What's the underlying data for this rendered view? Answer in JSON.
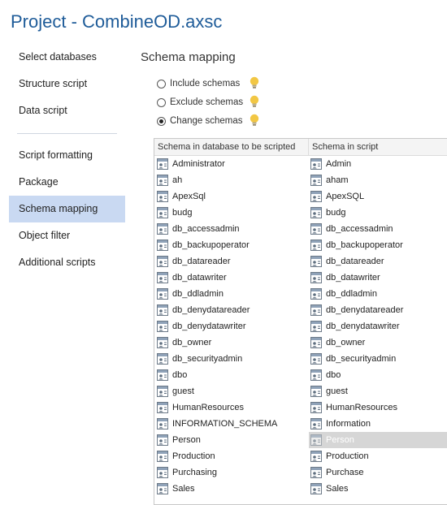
{
  "window": {
    "title": "Project - CombineOD.axsc"
  },
  "sidebar": {
    "items": [
      {
        "label": "Select databases"
      },
      {
        "label": "Structure script"
      },
      {
        "label": "Data script"
      },
      {
        "label": "Script formatting"
      },
      {
        "label": "Package"
      },
      {
        "label": "Schema mapping",
        "selected": true
      },
      {
        "label": "Object filter"
      },
      {
        "label": "Additional scripts"
      }
    ]
  },
  "main": {
    "section_title": "Schema mapping",
    "options": [
      {
        "label": "Include schemas",
        "checked": false
      },
      {
        "label": "Exclude schemas",
        "checked": false
      },
      {
        "label": "Change schemas",
        "checked": true
      }
    ],
    "grid": {
      "headers": [
        "Schema in database to be scripted",
        "Schema in script"
      ],
      "rows": [
        {
          "db": "Administrator",
          "script": "Admin"
        },
        {
          "db": "ah",
          "script": "aham"
        },
        {
          "db": "ApexSql",
          "script": "ApexSQL"
        },
        {
          "db": "budg",
          "script": "budg"
        },
        {
          "db": "db_accessadmin",
          "script": "db_accessadmin"
        },
        {
          "db": "db_backupoperator",
          "script": "db_backupoperator"
        },
        {
          "db": "db_datareader",
          "script": "db_datareader"
        },
        {
          "db": "db_datawriter",
          "script": "db_datawriter"
        },
        {
          "db": "db_ddladmin",
          "script": "db_ddladmin"
        },
        {
          "db": "db_denydatareader",
          "script": "db_denydatareader"
        },
        {
          "db": "db_denydatawriter",
          "script": "db_denydatawriter"
        },
        {
          "db": "db_owner",
          "script": "db_owner"
        },
        {
          "db": "db_securityadmin",
          "script": "db_securityadmin"
        },
        {
          "db": "dbo",
          "script": "dbo"
        },
        {
          "db": "guest",
          "script": "guest"
        },
        {
          "db": "HumanResources",
          "script": "HumanResources"
        },
        {
          "db": "INFORMATION_SCHEMA",
          "script": "Information"
        },
        {
          "db": "Person",
          "script": "Person",
          "selected": true
        },
        {
          "db": "Production",
          "script": "Production"
        },
        {
          "db": "Purchasing",
          "script": "Purchase"
        },
        {
          "db": "Sales",
          "script": "Sales"
        }
      ]
    }
  },
  "icons": {
    "schema": "schema-icon",
    "hint": "lightbulb-icon",
    "accent": "#1f5c99",
    "selected_nav_bg": "#c9d9f2",
    "bulb_color": "#f2c744"
  }
}
